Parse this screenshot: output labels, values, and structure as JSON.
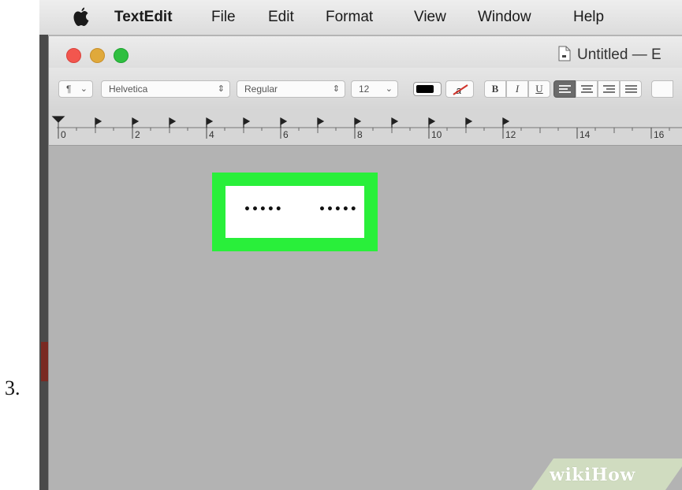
{
  "step_number": "3.",
  "menubar": {
    "app_name": "TextEdit",
    "items": [
      "File",
      "Edit",
      "Format",
      "View",
      "Window",
      "Help"
    ]
  },
  "window": {
    "title": "Untitled — E"
  },
  "formatbar": {
    "paragraph_style_icon": "pilcrow-icon",
    "font_family": "Helvetica",
    "font_style": "Regular",
    "font_size": "12",
    "text_color": "#000000",
    "bold_label": "B",
    "italic_label": "I",
    "underline_label": "U",
    "alignment_selected": "left"
  },
  "ruler": {
    "labels": [
      "0",
      "2",
      "4",
      "6",
      "8",
      "10",
      "12",
      "14",
      "16"
    ]
  },
  "document": {
    "highlight_color": "#29ef3a",
    "text_left": "•••••",
    "text_right": "•••••"
  },
  "watermark": "wikiHow"
}
